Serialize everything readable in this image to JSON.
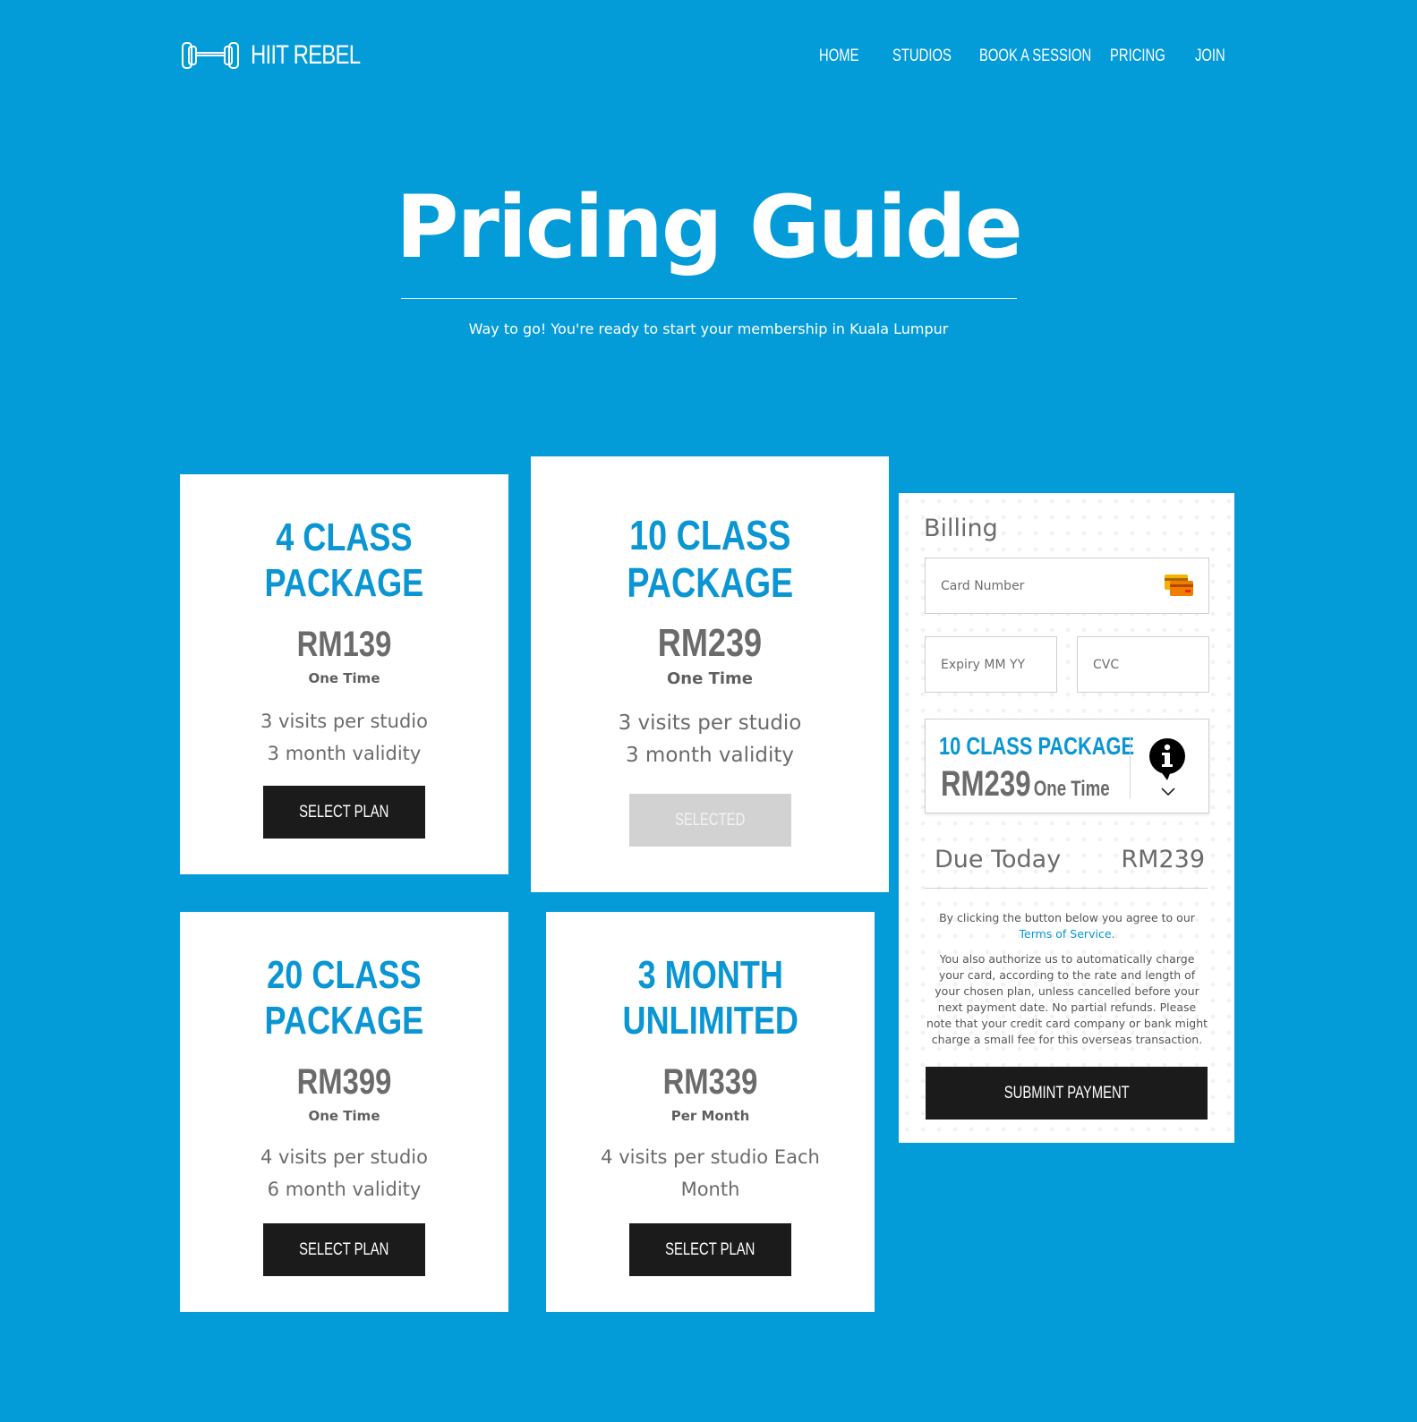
{
  "brand": {
    "name": "HIIT REBEL",
    "icon": "dumbbell-icon"
  },
  "nav": {
    "items": [
      {
        "label": "HOME"
      },
      {
        "label": "STUDIOS"
      },
      {
        "label": "BOOK A SESSION"
      },
      {
        "label": "PRICING"
      },
      {
        "label": "JOIN"
      }
    ]
  },
  "hero": {
    "title": "Pricing Guide",
    "subtitle": "Way to go! You're ready to start your membership in Kuala Lumpur"
  },
  "plans": [
    {
      "title_line1": "4 CLASS",
      "title_line2": "PACKAGE",
      "price": "RM139",
      "term": "One Time",
      "desc_line1": "3 visits per studio",
      "desc_line2": "3 month validity",
      "button": "SELECT PLAN",
      "selected": false
    },
    {
      "title_line1": "10 CLASS",
      "title_line2": "PACKAGE",
      "price": "RM239",
      "term": "One Time",
      "desc_line1": "3 visits per studio",
      "desc_line2": "3 month validity",
      "button": "SELECTED",
      "selected": true
    },
    {
      "title_line1": "20 CLASS",
      "title_line2": "PACKAGE",
      "price": "RM399",
      "term": "One Time",
      "desc_line1": "4 visits per studio",
      "desc_line2": "6 month validity",
      "button": "SELECT PLAN",
      "selected": false
    },
    {
      "title_line1": "3 MONTH",
      "title_line2": "UNLIMITED",
      "price": "RM339",
      "term": "Per Month",
      "desc_line1": "4 visits per studio Each",
      "desc_line2": "Month",
      "button": "SELECT PLAN",
      "selected": false
    }
  ],
  "billing": {
    "title": "Billing",
    "card_number": {
      "placeholder": "Card Number",
      "value": "",
      "icon": "credit-card-icon"
    },
    "expiry": {
      "placeholder": "Expiry MM YY",
      "value": ""
    },
    "cvc": {
      "placeholder": "CVC",
      "value": ""
    },
    "summary": {
      "package": "10 CLASS PACKAGE",
      "price": "RM239",
      "term": "One Time",
      "info_icon": "info-icon",
      "toggle_icon": "chevron-down-icon"
    },
    "due_label": "Due Today",
    "due_amount": "RM239",
    "agree_text": "By clicking the button below you agree to our",
    "terms_link": "Terms of Service.",
    "authorize_text": "You also authorize us to automatically charge your card, according to the rate and length of your chosen plan, unless cancelled before your next payment date. No partial refunds. Please note that your credit card company or bank might charge a small fee for this overseas transaction.",
    "submit_label": "SUBMINT PAYMENT"
  },
  "colors": {
    "background": "#049bd9",
    "accent": "#0a95d3",
    "button": "#1c1b1c",
    "button_selected": "#d3d2d3"
  }
}
